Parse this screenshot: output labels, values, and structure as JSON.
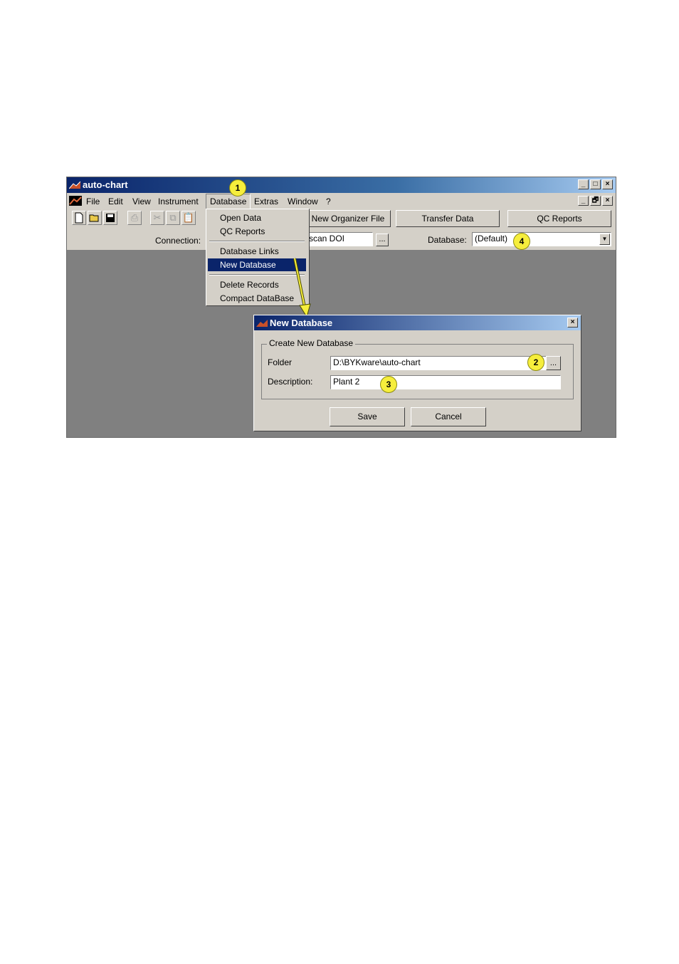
{
  "app": {
    "title": "auto-chart",
    "window_buttons": [
      "_",
      "□",
      "×"
    ],
    "mdi_buttons": [
      "_",
      "🗗",
      "×"
    ]
  },
  "menu": {
    "items": [
      "File",
      "Edit",
      "View",
      "Instrument",
      "Database",
      "Extras",
      "Window",
      "?"
    ]
  },
  "toolbar": {
    "buttons": [
      "New Organizer File",
      "Transfer Data",
      "QC Reports"
    ],
    "connection_label": "Connection:",
    "connection_value": "scan DOI",
    "browse_label": "...",
    "database_label": "Database:",
    "database_value": "(Default)"
  },
  "database_menu": {
    "items": [
      "Open Data",
      "QC Reports",
      "Database Links",
      "New Database",
      "Delete Records",
      "Compact DataBase"
    ],
    "selected": "New Database"
  },
  "dialog": {
    "title": "New Database",
    "group_title": "Create New Database",
    "folder_label": "Folder",
    "folder_value": "D:\\BYKware\\auto-chart",
    "browse_label": "...",
    "description_label": "Description:",
    "description_value": "Plant 2",
    "save_label": "Save",
    "cancel_label": "Cancel"
  },
  "markers": [
    "1",
    "2",
    "3",
    "4"
  ],
  "colors": {
    "title_bar": "#0a246a",
    "marker": "#f6ee3c",
    "workspace": "#808080",
    "face": "#d4d0c8"
  }
}
